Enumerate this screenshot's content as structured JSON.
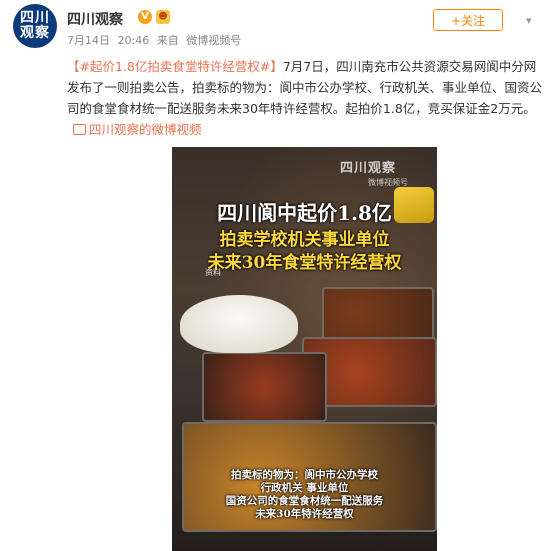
{
  "post": {
    "author": {
      "name": "四川观察",
      "avatar_line1": "四川",
      "avatar_line2": "观察",
      "verified_badge": "V"
    },
    "meta": {
      "date": "7月14日",
      "time": "20:46",
      "from_label": "来自",
      "source": "微博视频号"
    },
    "follow_label": "+关注",
    "more_icon": "chevron-down-icon",
    "hashtag": "【#起价1.8亿拍卖食堂特许经营权#】",
    "body": "7月7日，四川南充市公共资源交易网阆中分网发布了一则拍卖公告，拍卖标的物为：阆中市公办学校、行政机关、事业单位、国资公司的食堂食材统一配送服务未来30年特许经营权。起拍价1.8亿，竞买保证金2万元。",
    "source_link": "四川观察的微博视频"
  },
  "video": {
    "channel_logo": "四川观察",
    "weibo_watermark": "微博视频号",
    "title_line1": "四川阆中起价1.8亿",
    "title_line2": "拍卖学校机关事业单位",
    "title_line3": "未来30年食堂特许经营权",
    "material_label": "资料",
    "caption_line1": "拍卖标的物为：阆中市公办学校",
    "caption_line2": "行政机关 事业单位",
    "caption_line3": "国资公司的食堂食材统一配送服务",
    "caption_line4": "未来30年特许经营权"
  },
  "colors": {
    "accent": "#ff8200",
    "link": "#eb7350",
    "overlay_yellow": "#ffd93a"
  }
}
